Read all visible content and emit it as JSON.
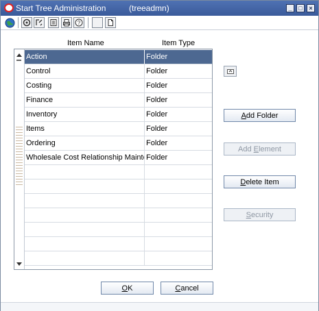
{
  "window": {
    "title": "Start Tree Administration",
    "subtitle": "(treeadmn)",
    "minimize_glyph": "_",
    "maximize_glyph": "□",
    "close_glyph": "×"
  },
  "toolbar": {
    "icons": [
      "globe-icon",
      "action-icon",
      "edit-icon",
      "detail-icon",
      "print-icon",
      "help-icon",
      "blank-icon",
      "new-document-icon"
    ]
  },
  "grid": {
    "columns": [
      "Item Name",
      "Item Type"
    ],
    "rows": [
      {
        "name": "Action",
        "type": "Folder",
        "selected": true
      },
      {
        "name": "Control",
        "type": "Folder"
      },
      {
        "name": "Costing",
        "type": "Folder"
      },
      {
        "name": "Finance",
        "type": "Folder"
      },
      {
        "name": "Inventory",
        "type": "Folder"
      },
      {
        "name": "Items",
        "type": "Folder"
      },
      {
        "name": "Ordering",
        "type": "Folder"
      },
      {
        "name": "Wholesale Cost Relationship Mainten",
        "type": "Folder"
      },
      {
        "name": "",
        "type": ""
      },
      {
        "name": "",
        "type": ""
      },
      {
        "name": "",
        "type": ""
      },
      {
        "name": "",
        "type": ""
      },
      {
        "name": "",
        "type": ""
      },
      {
        "name": "",
        "type": ""
      },
      {
        "name": "",
        "type": ""
      }
    ]
  },
  "buttons": {
    "add_folder": {
      "mnemonic": "A",
      "rest": "dd Folder"
    },
    "add_element": {
      "pre": "Add ",
      "mnemonic": "E",
      "rest": "lement"
    },
    "delete_item": {
      "mnemonic": "D",
      "rest": "elete Item"
    },
    "security": {
      "mnemonic": "S",
      "rest": "ecurity"
    },
    "ok": {
      "mnemonic": "O",
      "rest": "K"
    },
    "cancel": {
      "mnemonic": "C",
      "rest": "ancel"
    }
  },
  "colors": {
    "titlebar": "#3a5a9a",
    "selection": "#4d6891"
  }
}
